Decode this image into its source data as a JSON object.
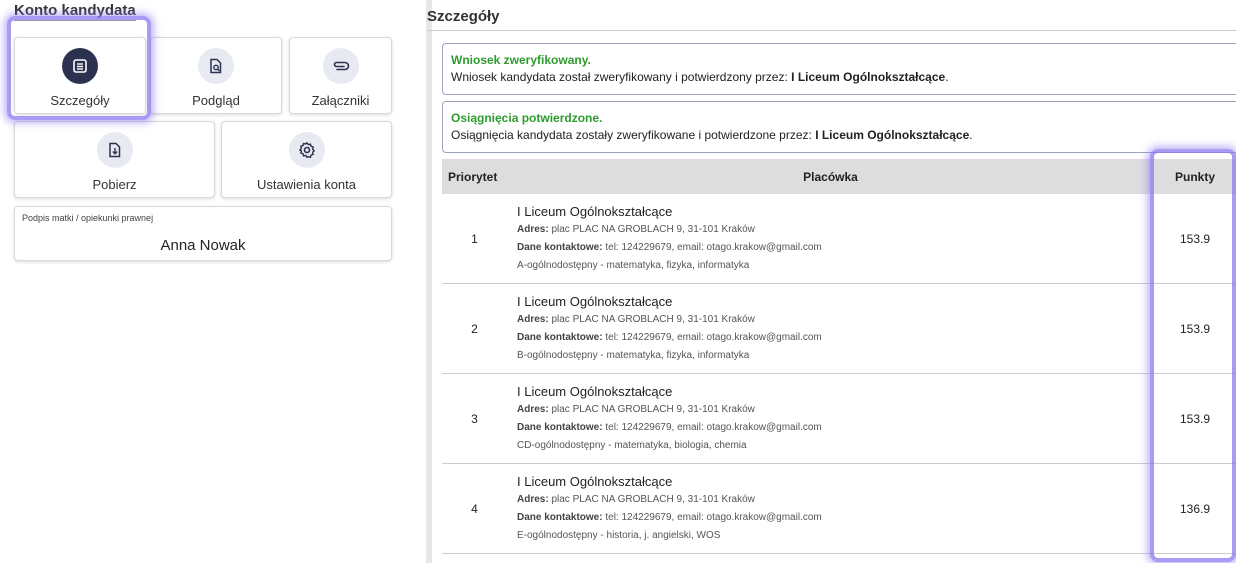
{
  "left": {
    "title": "Konto kandydata",
    "tiles": [
      {
        "label": "Szczegóły",
        "icon": "list-icon"
      },
      {
        "label": "Podgląd",
        "icon": "preview-icon"
      },
      {
        "label": "Załączniki",
        "icon": "attachment-icon"
      },
      {
        "label": "Pobierz",
        "icon": "download-icon"
      },
      {
        "label": "Ustawienia konta",
        "icon": "gear-icon"
      }
    ],
    "signature": {
      "caption": "Podpis matki / opiekunki prawnej",
      "name": "Anna Nowak"
    }
  },
  "right": {
    "title": "Szczegóły",
    "alerts": [
      {
        "heading": "Wniosek zweryfikowany.",
        "text": "Wniosek kandydata został zweryfikowany i potwierdzony przez: ",
        "strong": "I Liceum Ogólnokształcące",
        "end": "."
      },
      {
        "heading": "Osiągnięcia potwierdzone.",
        "text": "Osiągnięcia kandydata zostały zweryfikowane i potwierdzone przez: ",
        "strong": "I Liceum Ogólnokształcące",
        "end": "."
      }
    ],
    "table": {
      "headers": {
        "priority": "Priorytet",
        "school": "Placówka",
        "points": "Punkty"
      },
      "rows": [
        {
          "priority": "1",
          "name": "I Liceum Ogólnokształcące",
          "address_label": "Adres:",
          "address": " plac PLAC NA GROBLACH 9, 31-101 Kraków",
          "contact_label": "Dane kontaktowe:",
          "contact": " tel: 124229679, email: otago.krakow@gmail.com",
          "class": "A-ogólnodostępny - matematyka, fizyka, informatyka",
          "points": "153.9"
        },
        {
          "priority": "2",
          "name": "I Liceum Ogólnokształcące",
          "address_label": "Adres:",
          "address": " plac PLAC NA GROBLACH 9, 31-101 Kraków",
          "contact_label": "Dane kontaktowe:",
          "contact": " tel: 124229679, email: otago.krakow@gmail.com",
          "class": "B-ogólnodostępny - matematyka, fizyka, informatyka",
          "points": "153.9"
        },
        {
          "priority": "3",
          "name": "I Liceum Ogólnokształcące",
          "address_label": "Adres:",
          "address": " plac PLAC NA GROBLACH 9, 31-101 Kraków",
          "contact_label": "Dane kontaktowe:",
          "contact": " tel: 124229679, email: otago.krakow@gmail.com",
          "class": "CD-ogólnodostępny - matematyka, biologia, chemia",
          "points": "153.9"
        },
        {
          "priority": "4",
          "name": "I Liceum Ogólnokształcące",
          "address_label": "Adres:",
          "address": " plac PLAC NA GROBLACH 9, 31-101 Kraków",
          "contact_label": "Dane kontaktowe:",
          "contact": " tel: 124229679, email: otago.krakow@gmail.com",
          "class": "E-ogólnodostępny - historia, j. angielski, WOS",
          "points": "136.9"
        }
      ]
    }
  }
}
